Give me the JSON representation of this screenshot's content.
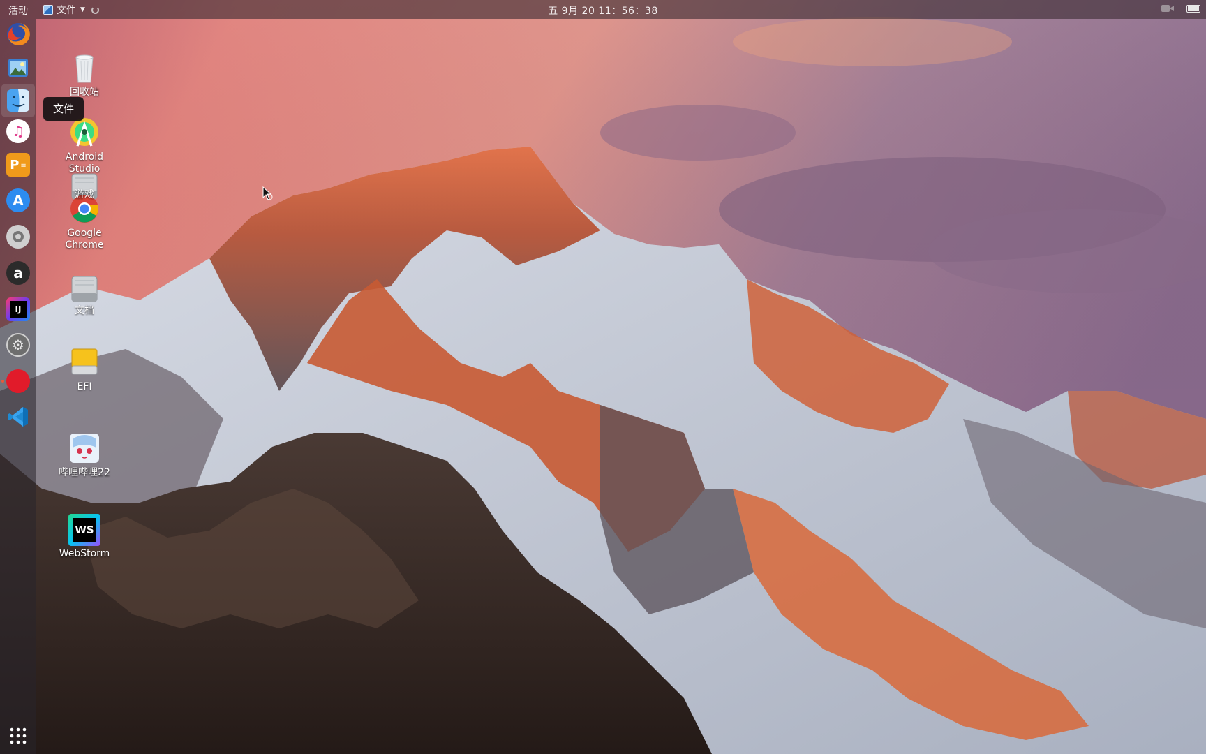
{
  "topbar": {
    "activities_label": "活动",
    "app_menu_label": "文件",
    "clock": "五 9月 20 11：56：38"
  },
  "dock": {
    "items": [
      {
        "name": "Firefox",
        "icon": "firefox-icon"
      },
      {
        "name": "Image viewer",
        "icon": "photo-icon"
      },
      {
        "name": "文件",
        "icon": "finder-icon",
        "active": true
      },
      {
        "name": "Music",
        "icon": "music-icon"
      },
      {
        "name": "Presentation",
        "icon": "presentation-icon"
      },
      {
        "name": "App Store",
        "icon": "app-store-icon"
      },
      {
        "name": "Help",
        "icon": "help-icon"
      },
      {
        "name": "Amazon",
        "icon": "amazon-icon",
        "glyph": "a"
      },
      {
        "name": "IntelliJ IDEA",
        "icon": "intellij-icon",
        "glyph": "IJ"
      },
      {
        "name": "Settings",
        "icon": "settings-icon"
      },
      {
        "name": "Recorder",
        "icon": "record-icon"
      },
      {
        "name": "VS Code",
        "icon": "vscode-icon"
      },
      {
        "name": "Show Applications",
        "icon": "app-grid-icon"
      }
    ],
    "tooltip": "文件"
  },
  "desktop": {
    "icons": [
      {
        "label": "回收站",
        "icon": "trash-icon"
      },
      {
        "label": "Android Studio",
        "icon": "android-studio-icon"
      },
      {
        "label": "游戏",
        "icon": "drive-icon"
      },
      {
        "label": "Google Chrome",
        "icon": "chrome-icon"
      },
      {
        "label": "文档",
        "icon": "drive-icon"
      },
      {
        "label": "EFI",
        "icon": "efi-drive-icon"
      },
      {
        "label": "哔哩哔哩22",
        "icon": "bilibili-icon"
      },
      {
        "label": "WebStorm",
        "icon": "webstorm-icon",
        "glyph": "WS"
      }
    ]
  },
  "colors": {
    "topbar_bg": "#3c2c32",
    "accent_orange": "#e65a3a",
    "sky_pink": "#e98a78",
    "sky_purple": "#8d6c8a"
  }
}
